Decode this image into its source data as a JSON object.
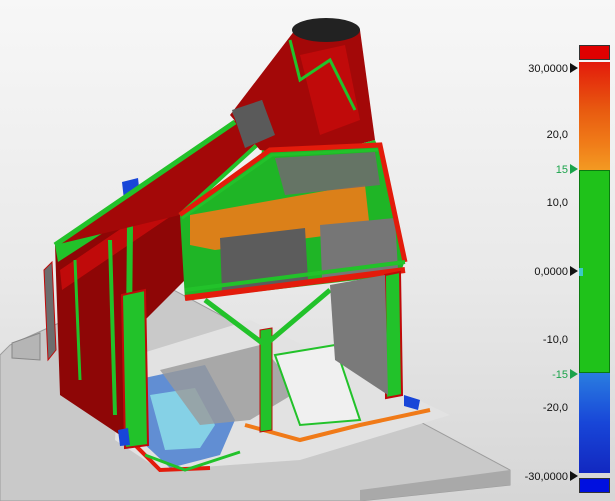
{
  "legend": {
    "top_cap_color": "#e00000",
    "bottom_cap_color": "#0010e0",
    "ticks": [
      {
        "id": "max",
        "label": "30,0000",
        "style": "black",
        "arrow": true
      },
      {
        "id": "t20",
        "label": "20,0",
        "style": "black",
        "arrow": false
      },
      {
        "id": "upper-limit",
        "label": "15",
        "style": "green",
        "arrow": true
      },
      {
        "id": "t10",
        "label": "10,0",
        "style": "black",
        "arrow": false
      },
      {
        "id": "zero",
        "label": "0,0000",
        "style": "black",
        "arrow": true
      },
      {
        "id": "tm10",
        "label": "-10,0",
        "style": "black",
        "arrow": false
      },
      {
        "id": "lower-limit",
        "label": "-15",
        "style": "green",
        "arrow": true
      },
      {
        "id": "tm20",
        "label": "-20,0",
        "style": "black",
        "arrow": false
      },
      {
        "id": "min",
        "label": "-30,0000",
        "style": "black",
        "arrow": true
      }
    ],
    "colors": {
      "red": "#e31b0b",
      "orange_dark": "#e85a10",
      "orange": "#f07a18",
      "orange_light": "#f39a22",
      "green": "#1fc21a",
      "cyan": "#3cc8c8",
      "blue_light": "#2a7de0",
      "blue": "#1846d8",
      "blue_dark": "#1228c0"
    }
  },
  "model": {
    "colors": {
      "deviation_red": "#c00a0a",
      "dark_red": "#8e0606",
      "frame_green": "#22c22a",
      "grey_mesh": "#6d6d6d",
      "light_grey": "#bdbdbd",
      "floor": "#c9c9c9",
      "floor_edge": "#a9a9a9",
      "blue_patch": "#4a7fd0",
      "cyan_patch": "#8ad8e8"
    }
  }
}
